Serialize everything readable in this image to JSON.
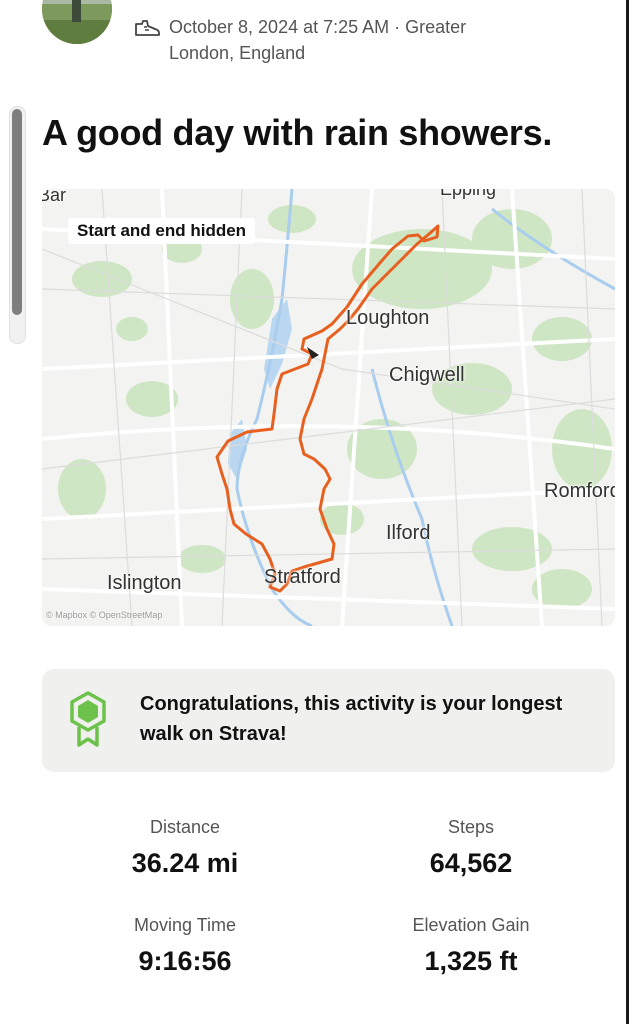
{
  "activity": {
    "date_location": "October 8, 2024 at 7:25 AM · Greater London, England",
    "title": "A good day with rain showers."
  },
  "map": {
    "privacy_badge": "Start and end hidden",
    "attribution": "© Mapbox © OpenStreetMap",
    "places": {
      "epping": "Epping",
      "loughton": "Loughton",
      "chigwell": "Chigwell",
      "romford": "Romford",
      "ilford": "Ilford",
      "islington": "Islington",
      "stratford": "Stratford",
      "barnet": "Bar"
    },
    "route_color": "#e8601f"
  },
  "achievement": {
    "message": "Congratulations, this activity is your longest walk on Strava!",
    "accent_color": "#6cc24a"
  },
  "stats": [
    {
      "label": "Distance",
      "value": "36.24 mi"
    },
    {
      "label": "Steps",
      "value": "64,562"
    },
    {
      "label": "Moving Time",
      "value": "9:16:56"
    },
    {
      "label": "Elevation Gain",
      "value": "1,325 ft"
    }
  ]
}
